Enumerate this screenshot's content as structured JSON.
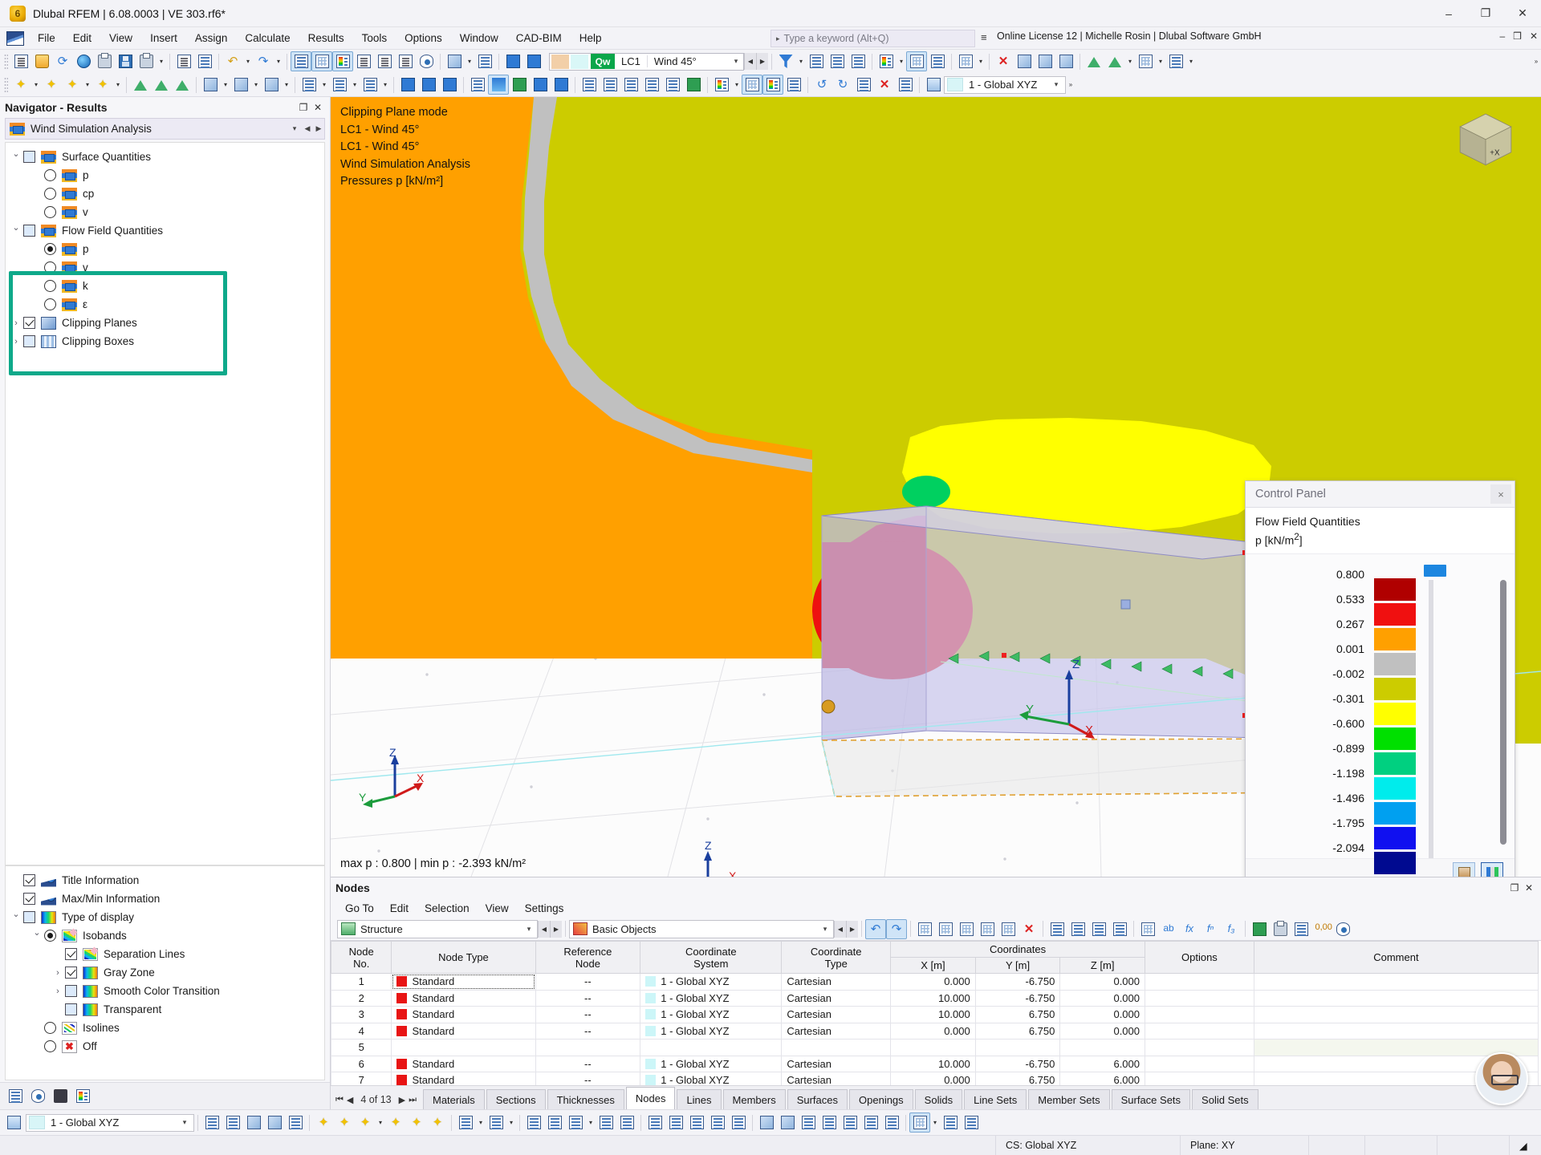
{
  "window": {
    "title": "Dlubal RFEM | 6.08.0003 | VE 303.rf6*",
    "minimize": "–",
    "maximize": "❐",
    "close": "✕"
  },
  "menubar": {
    "items": [
      "File",
      "Edit",
      "View",
      "Insert",
      "Assign",
      "Calculate",
      "Results",
      "Tools",
      "Options",
      "Window",
      "CAD-BIM",
      "Help"
    ],
    "search_placeholder": "Type a keyword (Alt+Q)",
    "license": "Online License 12 | Michelle Rosin | Dlubal Software GmbH"
  },
  "toolbar": {
    "load_case": {
      "id": "LC1",
      "name": "Wind 45°",
      "qw": "Qw"
    },
    "coordinate_system": "1 - Global XYZ",
    "overflow": "»"
  },
  "navigator": {
    "title": "Navigator - Results",
    "pin": "❐",
    "close": "✕",
    "prev": "◀",
    "next": "▶",
    "combo_value": "Wind Simulation Analysis",
    "combo_caret": "⌄",
    "tree": [
      {
        "label": "Surface Quantities",
        "type": "checkbox",
        "checked": false,
        "twist": "open",
        "icon": "wind-simulation-icon",
        "indent": 0
      },
      {
        "label": "p",
        "type": "radio",
        "checked": false,
        "icon": "wind-simulation-icon",
        "indent": 1
      },
      {
        "label": "cp",
        "type": "radio",
        "checked": false,
        "icon": "wind-simulation-icon",
        "indent": 1
      },
      {
        "label": "v",
        "type": "radio",
        "checked": false,
        "icon": "wind-simulation-icon",
        "indent": 1
      },
      {
        "label": "Flow Field Quantities",
        "type": "checkbox",
        "checked": false,
        "twist": "open",
        "icon": "wind-simulation-icon",
        "indent": 0
      },
      {
        "label": "p",
        "type": "radio",
        "checked": true,
        "icon": "wind-simulation-icon",
        "indent": 1
      },
      {
        "label": "v",
        "type": "radio",
        "checked": false,
        "icon": "wind-simulation-icon",
        "indent": 1
      },
      {
        "label": "k",
        "type": "radio",
        "checked": false,
        "icon": "wind-simulation-icon",
        "indent": 1
      },
      {
        "label": "ε",
        "type": "radio",
        "checked": false,
        "icon": "wind-simulation-icon",
        "indent": 1
      },
      {
        "label": "Clipping Planes",
        "type": "checkbox",
        "checked": true,
        "twist": "closed",
        "icon": "clipping-plane-icon",
        "indent": 0
      },
      {
        "label": "Clipping Boxes",
        "type": "checkbox",
        "checked": false,
        "twist": "closed",
        "icon": "clipping-box-icon",
        "indent": 0
      }
    ],
    "display_tree": [
      {
        "label": "Title Information",
        "type": "checkbox",
        "checked": true,
        "icon": "title-info-icon",
        "indent": 0
      },
      {
        "label": "Max/Min Information",
        "type": "checkbox",
        "checked": true,
        "icon": "maxmin-info-icon",
        "indent": 0
      },
      {
        "label": "Type of display",
        "type": "checkbox",
        "checked": false,
        "twist": "open",
        "icon": "rainbow-icon",
        "indent": 0
      },
      {
        "label": "Isobands",
        "type": "radio",
        "checked": true,
        "twist": "open",
        "icon": "isobands-icon",
        "indent": 1
      },
      {
        "label": "Separation Lines",
        "type": "checkbox",
        "checked": true,
        "icon": "isobands-icon",
        "indent": 2
      },
      {
        "label": "Gray Zone",
        "type": "checkbox",
        "checked": true,
        "twist": "closed",
        "icon": "rainbow-icon",
        "indent": 2
      },
      {
        "label": "Smooth Color Transition",
        "type": "checkbox",
        "checked": false,
        "twist": "closed",
        "icon": "rainbow-icon",
        "indent": 2
      },
      {
        "label": "Transparent",
        "type": "checkbox",
        "checked": false,
        "icon": "rainbow-icon",
        "indent": 2
      },
      {
        "label": "Isolines",
        "type": "radio",
        "checked": false,
        "icon": "isolines-icon",
        "indent": 1
      },
      {
        "label": "Off",
        "type": "radio",
        "checked": false,
        "icon": "off-icon",
        "indent": 1
      }
    ]
  },
  "viewport": {
    "title_lines": [
      "Clipping Plane mode",
      "LC1 - Wind 45°",
      "LC1 - Wind 45°",
      "Wind Simulation Analysis",
      "Pressures p [kN/m²]"
    ],
    "minmax": "max p : 0.800 | min p : -2.393 kN/m²",
    "cube_label": "+X",
    "axes": {
      "x": "X",
      "y": "Y",
      "z": "Z"
    }
  },
  "control_panel": {
    "title": "Control Panel",
    "close": "×",
    "quantity": "Flow Field Quantities",
    "unit_label": "p [kN/m²]"
  },
  "chart_data": {
    "type": "heatmap",
    "title": "Flow Field Quantities  p [kN/m2]",
    "ylabel": "p [kN/m²]",
    "legend_position": "right",
    "tick_labels": [
      "0.800",
      "0.533",
      "0.267",
      "0.001",
      "-0.002",
      "-0.301",
      "-0.600",
      "-0.899",
      "-1.198",
      "-1.496",
      "-1.795",
      "-2.094"
    ],
    "tick_values": [
      0.8,
      0.533,
      0.267,
      0.001,
      -0.002,
      -0.301,
      -0.6,
      -0.899,
      -1.198,
      -1.496,
      -1.795,
      -2.094
    ],
    "band_colors": [
      "#b00000",
      "#f01010",
      "#ffa000",
      "#c0c0c0",
      "#cccc00",
      "#ffff00",
      "#00e000",
      "#00d080",
      "#00ecec",
      "#00a0f0",
      "#1010f0",
      "#000a90"
    ],
    "max": 0.8,
    "min": -2.393,
    "unit": "kN/m2"
  },
  "nodes_panel": {
    "title": "Nodes",
    "menu": [
      "Go To",
      "Edit",
      "Selection",
      "View",
      "Settings"
    ],
    "combo_left": "Structure",
    "combo_right": "Basic Objects",
    "columns_top": [
      "Node",
      "Node Type",
      "Reference",
      "Coordinate",
      "Coordinate",
      "Coordinates",
      "",
      "",
      "Options",
      "Comment"
    ],
    "headers": {
      "node_no": [
        "Node",
        "No."
      ],
      "node_type": [
        "",
        "Node Type"
      ],
      "reference_node": [
        "Reference",
        "Node"
      ],
      "coordinate_system": [
        "Coordinate",
        "System"
      ],
      "coordinate_type": [
        "Coordinate",
        "Type"
      ],
      "coordinates_group": "Coordinates",
      "x": "X [m]",
      "y": "Y [m]",
      "z": "Z [m]",
      "options": "Options",
      "comment": "Comment"
    },
    "rows": [
      {
        "no": "1",
        "type": "Standard",
        "ref": "--",
        "cs": "1 - Global XYZ",
        "ctype": "Cartesian",
        "x": "0.000",
        "y": "-6.750",
        "z": "0.000",
        "options": "",
        "comment": ""
      },
      {
        "no": "2",
        "type": "Standard",
        "ref": "--",
        "cs": "1 - Global XYZ",
        "ctype": "Cartesian",
        "x": "10.000",
        "y": "-6.750",
        "z": "0.000",
        "options": "",
        "comment": ""
      },
      {
        "no": "3",
        "type": "Standard",
        "ref": "--",
        "cs": "1 - Global XYZ",
        "ctype": "Cartesian",
        "x": "10.000",
        "y": "6.750",
        "z": "0.000",
        "options": "",
        "comment": ""
      },
      {
        "no": "4",
        "type": "Standard",
        "ref": "--",
        "cs": "1 - Global XYZ",
        "ctype": "Cartesian",
        "x": "0.000",
        "y": "6.750",
        "z": "0.000",
        "options": "",
        "comment": ""
      },
      {
        "no": "5",
        "type": "",
        "ref": "",
        "cs": "",
        "ctype": "",
        "x": "",
        "y": "",
        "z": "",
        "options": "",
        "comment": ""
      },
      {
        "no": "6",
        "type": "Standard",
        "ref": "--",
        "cs": "1 - Global XYZ",
        "ctype": "Cartesian",
        "x": "10.000",
        "y": "-6.750",
        "z": "6.000",
        "options": "",
        "comment": ""
      },
      {
        "no": "7",
        "type": "Standard",
        "ref": "--",
        "cs": "1 - Global XYZ",
        "ctype": "Cartesian",
        "x": "0.000",
        "y": "6.750",
        "z": "6.000",
        "options": "",
        "comment": ""
      }
    ],
    "pager": {
      "first": "⏮",
      "prev": "◀",
      "text": "4 of 13",
      "next": "▶",
      "last": "⏭"
    },
    "tabs": [
      "Materials",
      "Sections",
      "Thicknesses",
      "Nodes",
      "Lines",
      "Members",
      "Surfaces",
      "Openings",
      "Solids",
      "Line Sets",
      "Member Sets",
      "Surface Sets",
      "Solid Sets"
    ],
    "active_tab": "Nodes"
  },
  "bottom": {
    "coordinate_system": "1 - Global XYZ"
  },
  "status": {
    "cs": "CS: Global XYZ",
    "plane": "Plane: XY"
  },
  "colors": {
    "highlight": "#0ea98a",
    "accent": "#2f7ad4",
    "green": "#0aa64a"
  }
}
